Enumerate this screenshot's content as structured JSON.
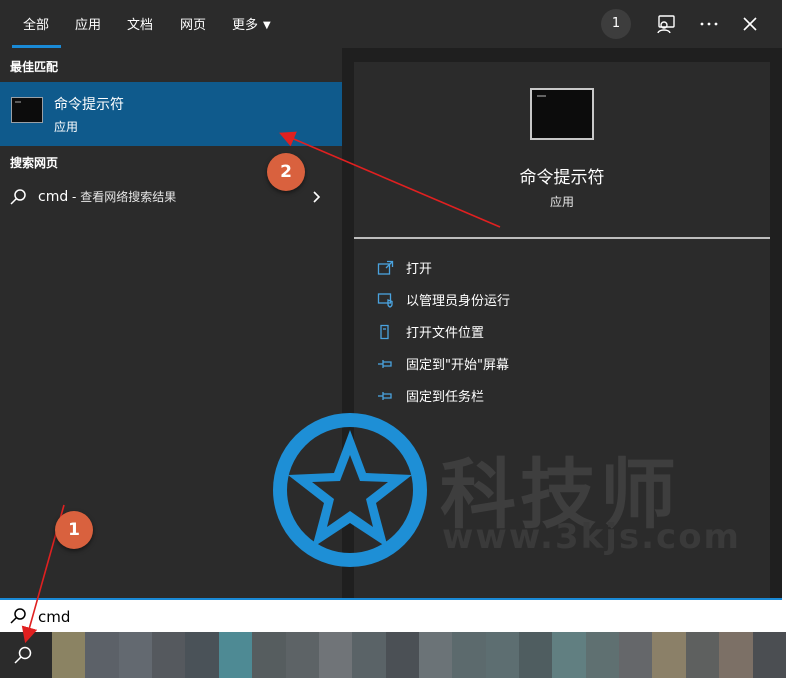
{
  "tabs": [
    {
      "label": "全部",
      "active": true
    },
    {
      "label": "应用"
    },
    {
      "label": "文档"
    },
    {
      "label": "网页"
    },
    {
      "label": "更多",
      "has_dropdown": true
    }
  ],
  "top_icons": {
    "badge_count": "1",
    "feedback_icon": "feedback-person-icon",
    "more_icon": "more-dots-icon",
    "close_icon": "close-icon"
  },
  "best_match": {
    "section_title": "最佳匹配",
    "name": "命令提示符",
    "type": "应用",
    "icon": "command-prompt-icon"
  },
  "web_search": {
    "section_title": "搜索网页",
    "query": "cmd",
    "separator": " - ",
    "hint": "查看网络搜索结果",
    "icon": "search-icon",
    "chevron_icon": "chevron-right-icon"
  },
  "detail": {
    "name": "命令提示符",
    "type": "应用",
    "actions": [
      {
        "label": "打开",
        "icon": "open-icon"
      },
      {
        "label": "以管理员身份运行",
        "icon": "run-as-admin-icon"
      },
      {
        "label": "打开文件位置",
        "icon": "file-location-icon"
      },
      {
        "label": "固定到\"开始\"屏幕",
        "icon": "pin-start-icon"
      },
      {
        "label": "固定到任务栏",
        "icon": "pin-taskbar-icon"
      }
    ]
  },
  "search_box": {
    "value": "cmd",
    "icon": "search-icon"
  },
  "annotations": {
    "marker_1": "1",
    "marker_2": "2"
  },
  "watermark": {
    "text": "科技师",
    "url": "www.3kjs.com"
  },
  "colors": {
    "panel_bg": "#2b2b2b",
    "right_bg": "#1f1f1f",
    "highlight": "#0f5a8c",
    "accent": "#1a8ad6",
    "marker": "#d9613e",
    "arrow": "#e02020",
    "watermark_logo": "#1e8fd6"
  },
  "taskbar_colors": [
    "#8b8363",
    "#5c6168",
    "#636970",
    "#55595e",
    "#4a5258",
    "#4e8a94",
    "#565d5f",
    "#5d6366",
    "#707478",
    "#5a6367",
    "#4b5055",
    "#6b7377",
    "#5c6a6d",
    "#5d6e71",
    "#4f5d60",
    "#617f81",
    "#5f7071",
    "#65676a",
    "#8b8068",
    "#5e605f",
    "#7c7066",
    "#4b4e52"
  ]
}
